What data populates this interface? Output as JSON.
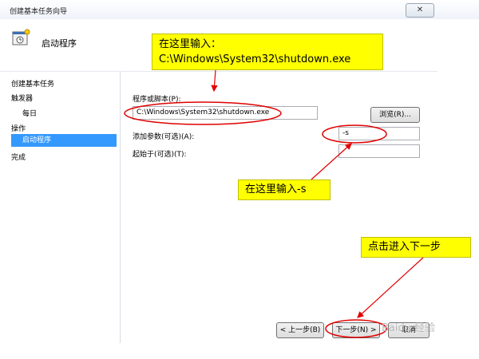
{
  "window": {
    "title": "创建基本任务向导",
    "close_glyph": "✕"
  },
  "header": {
    "title": "启动程序",
    "icon": "task-wizard-icon"
  },
  "nav": {
    "items": [
      {
        "label": "创建基本任务"
      },
      {
        "label": "触发器"
      },
      {
        "label": "每日"
      },
      {
        "label": "操作"
      },
      {
        "label": "启动程序"
      },
      {
        "label": "完成"
      }
    ],
    "selected": "启动程序"
  },
  "form": {
    "program_label": "程序或脚本(P):",
    "program_value": "C:\\Windows\\System32\\shutdown.exe",
    "browse_label": "浏览(R)...",
    "args_label": "添加参数(可选)(A):",
    "args_value": "-s",
    "start_in_label": "起始于(可选)(T):",
    "start_in_value": ""
  },
  "buttons": {
    "back": "< 上一步(B)",
    "next": "下一步(N) >",
    "cancel": "取消"
  },
  "annotations": {
    "note1_line1": "在这里输入：",
    "note1_line2": "C:\\Windows\\System32\\shutdown.exe",
    "note2": "在这里输入-s",
    "note3": "点击进入下一步"
  },
  "colors": {
    "selection": "#3399ff",
    "note_bg": "#ffff00",
    "annotation_red": "#e00000"
  },
  "watermark": "Baidu 经验"
}
